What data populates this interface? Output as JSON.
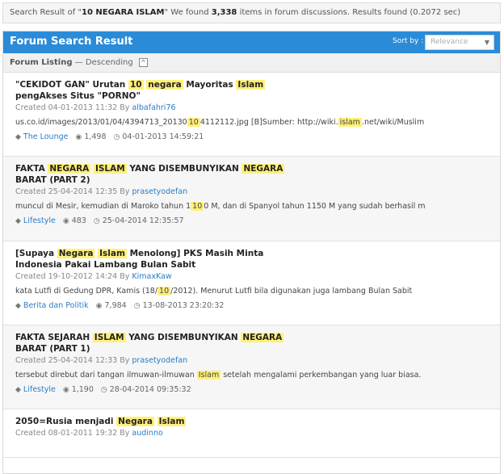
{
  "summary": {
    "prefix": "Search Result of \"",
    "query": "10 NEGARA ISLAM",
    "mid1": "\" We found ",
    "count": "3,338",
    "mid2": " items in forum discussions. Results found (0.2072 sec)"
  },
  "panel": {
    "title": "Forum Search Result",
    "sort_label": "Sort by :",
    "sort_value": "Relevance"
  },
  "listing": {
    "label": "Forum Listing",
    "order": " — Descending",
    "collapse_symbol": "^"
  },
  "results": [
    {
      "title": [
        {
          "t": "\"CEKIDOT GAN\" Urutan "
        },
        {
          "t": "10",
          "h": true
        },
        {
          "t": " "
        },
        {
          "t": "negara",
          "h": true
        },
        {
          "t": " Mayoritas "
        },
        {
          "t": "Islam",
          "h": true
        },
        {
          "t": " pengAkses Situs \"PORNO\""
        }
      ],
      "created": "Created 04-01-2013 11:32 By ",
      "author": "albafahri76",
      "snippet": [
        {
          "t": "us.co.id/images/2013/01/04/4394713_20130"
        },
        {
          "t": "10",
          "h": true
        },
        {
          "t": "4112112.jpg [B]Sumber: http://wiki."
        },
        {
          "t": "islam",
          "h": true
        },
        {
          "t": ".net/wiki/Muslim"
        }
      ],
      "category": "The Lounge",
      "views": "1,498",
      "last": "04-01-2013 14:59:21"
    },
    {
      "title": [
        {
          "t": "FAKTA "
        },
        {
          "t": "NEGARA",
          "h": true
        },
        {
          "t": " "
        },
        {
          "t": "ISLAM",
          "h": true
        },
        {
          "t": " YANG DISEMBUNYIKAN "
        },
        {
          "t": "NEGARA",
          "h": true
        },
        {
          "t": " BARAT (PART 2)"
        }
      ],
      "created": "Created 25-04-2014 12:35 By ",
      "author": "prasetyodefan",
      "snippet": [
        {
          "t": "muncul di Mesir, kemudian di Maroko tahun 1"
        },
        {
          "t": "10",
          "h": true
        },
        {
          "t": "0 M, dan di Spanyol tahun 1150 M yang sudah berhasil m"
        }
      ],
      "category": "Lifestyle",
      "views": "483",
      "last": "25-04-2014 12:35:57"
    },
    {
      "title": [
        {
          "t": "[Supaya "
        },
        {
          "t": "Negara",
          "h": true
        },
        {
          "t": " "
        },
        {
          "t": "Islam",
          "h": true
        },
        {
          "t": " Menolong] PKS Masih Minta Indonesia Pakai Lambang Bulan Sabit"
        }
      ],
      "created": "Created 19-10-2012 14:24 By ",
      "author": "KimaxKaw",
      "snippet": [
        {
          "t": "kata Lutfi di Gedung DPR, Kamis (18/"
        },
        {
          "t": "10",
          "h": true
        },
        {
          "t": "/2012). Menurut Lutfi bila digunakan juga lambang Bulan Sabit"
        }
      ],
      "category": "Berita dan Politik",
      "views": "7,984",
      "last": "13-08-2013 23:20:32"
    },
    {
      "title": [
        {
          "t": "FAKTA SEJARAH "
        },
        {
          "t": "ISLAM",
          "h": true
        },
        {
          "t": " YANG DISEMBUNYIKAN "
        },
        {
          "t": "NEGARA",
          "h": true
        },
        {
          "t": " BARAT (PART 1)"
        }
      ],
      "created": "Created 25-04-2014 12:33 By ",
      "author": "prasetyodefan",
      "snippet": [
        {
          "t": "tersebut direbut dari tangan ilmuwan-ilmuwan "
        },
        {
          "t": "Islam",
          "h": true
        },
        {
          "t": " setelah mengalami perkembangan yang luar biasa."
        }
      ],
      "category": "Lifestyle",
      "views": "1,190",
      "last": "28-04-2014 09:35:32"
    },
    {
      "title": [
        {
          "t": "2050=Rusia menjadi "
        },
        {
          "t": "Negara",
          "h": true
        },
        {
          "t": " "
        },
        {
          "t": "Islam",
          "h": true
        }
      ],
      "created": "Created 08-01-2011 19:32 By ",
      "author": "audinno",
      "snippet": [],
      "category": "",
      "views": "",
      "last": ""
    }
  ]
}
